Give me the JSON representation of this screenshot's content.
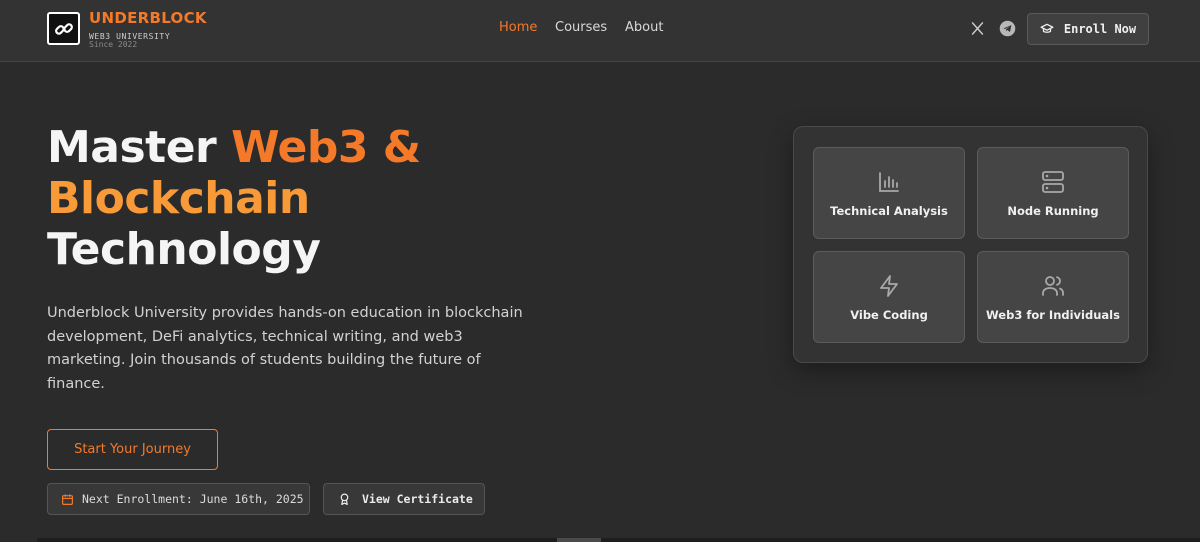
{
  "brand": {
    "name": "UNDERBLOCK",
    "subtitle": "WEB3 UNIVERSITY",
    "since": "Since 2022",
    "logo_icon": "chain-link-icon"
  },
  "nav": {
    "links": [
      {
        "label": "Home",
        "active": true
      },
      {
        "label": "Courses",
        "active": false
      },
      {
        "label": "About",
        "active": false
      }
    ],
    "social": [
      "x-icon",
      "telegram-icon"
    ],
    "enroll_label": "Enroll Now",
    "enroll_icon": "graduation-cap-icon"
  },
  "hero": {
    "title_part1": "Master ",
    "title_accent1": "Web3 &",
    "title_accent2": "Blockchain",
    "title_part3": "Technology",
    "description": "Underblock University provides hands-on education in blockchain development, DeFi analytics, technical writing, and web3 marketing. Join thousands of students building the future of finance.",
    "cta_label": "Start Your Journey",
    "enrollment_text": "Next Enrollment: June 16th, 2025",
    "enrollment_icon": "calendar-icon",
    "certificate_label": "View Certificate",
    "certificate_icon": "award-icon"
  },
  "courses": [
    {
      "label": "Technical Analysis",
      "icon": "bar-chart-icon"
    },
    {
      "label": "Node Running",
      "icon": "server-icon"
    },
    {
      "label": "Vibe Coding",
      "icon": "lightning-icon"
    },
    {
      "label": "Web3 for Individuals",
      "icon": "users-icon"
    }
  ],
  "colors": {
    "accent": "#f47a2a",
    "accent_light": "#f99a38",
    "background": "#2b2b2b",
    "navbar": "#333333"
  }
}
